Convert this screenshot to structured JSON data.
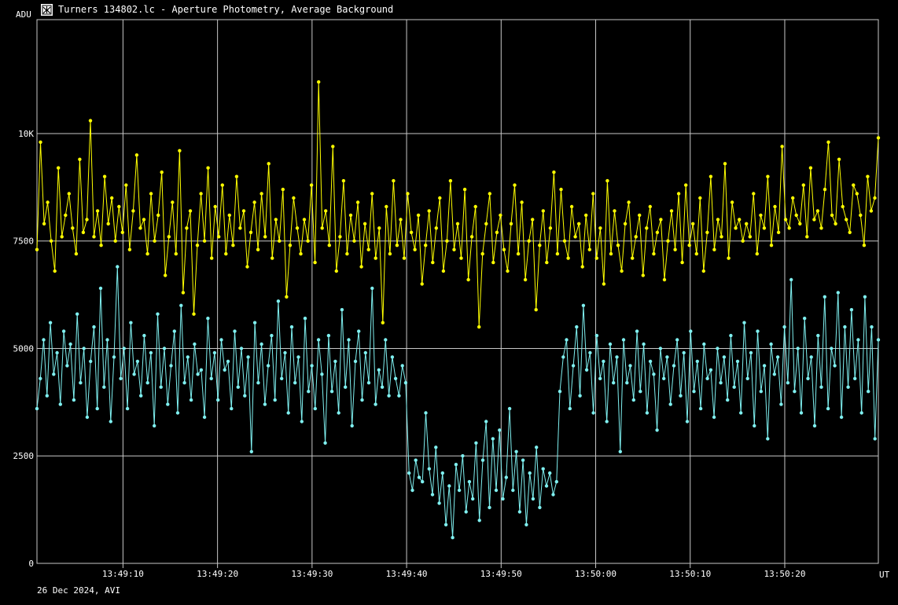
{
  "window": {
    "title": "Turners 134802.lc - Aperture Photometry, Average Background",
    "icon": "photometry-app-icon"
  },
  "footer": {
    "date_text": "26 Dec 2024, AVI"
  },
  "colors": {
    "background": "#000000",
    "grid": "#c8c8c8",
    "series_target": "#ffff00",
    "series_comparison": "#7ff0f0"
  },
  "chart_data": {
    "type": "line",
    "title": "Turners 134802.lc - Aperture Photometry, Average Background",
    "xlabel": "UT",
    "ylabel": "ADU",
    "x_start": "13:49:00.9",
    "x_end": "13:50:29.9",
    "x_tick_labels": [
      "13:49:10",
      "13:49:20",
      "13:49:30",
      "13:49:40",
      "13:49:50",
      "13:50:00",
      "13:50:10",
      "13:50:20"
    ],
    "y_tick_labels": [
      "0",
      "2500",
      "5000",
      "7500",
      "10K"
    ],
    "y_ticks": [
      0,
      2500,
      5000,
      7500,
      10000
    ],
    "ylim": [
      0,
      12650
    ],
    "grid": true,
    "series": [
      {
        "color": "#ffff00",
        "values": [
          7300,
          9800,
          7900,
          8400,
          7500,
          6800,
          9200,
          7600,
          8100,
          8600,
          7800,
          7200,
          9400,
          7700,
          8000,
          10300,
          7600,
          8200,
          7400,
          9000,
          7900,
          8500,
          7500,
          8300,
          7700,
          8800,
          7300,
          8200,
          9500,
          7800,
          8000,
          7200,
          8600,
          7500,
          8100,
          9100,
          6700,
          7600,
          8400,
          7200,
          9600,
          6300,
          7800,
          8200,
          5800,
          7400,
          8600,
          7500,
          9200,
          7100,
          8300,
          7600,
          8800,
          7200,
          8100,
          7400,
          9000,
          7800,
          8200,
          6900,
          7700,
          8400,
          7300,
          8600,
          7600,
          9300,
          7100,
          8000,
          7500,
          8700,
          6200,
          7400,
          8500,
          7800,
          7200,
          8000,
          7500,
          8800,
          7000,
          11200,
          7800,
          8200,
          7400,
          9700,
          6800,
          7600,
          8900,
          7200,
          8100,
          7500,
          8400,
          6900,
          7900,
          7300,
          8600,
          7100,
          7800,
          5600,
          8300,
          7200,
          8900,
          7400,
          8000,
          7100,
          8600,
          7700,
          7300,
          8100,
          6500,
          7400,
          8200,
          7000,
          7800,
          8500,
          6800,
          7500,
          8900,
          7300,
          7900,
          7100,
          8700,
          6600,
          7600,
          8300,
          5500,
          7200,
          7900,
          8600,
          7000,
          7700,
          8100,
          7300,
          6800,
          7900,
          8800,
          7200,
          8400,
          6600,
          7500,
          8000,
          5900,
          7400,
          8200,
          7000,
          7800,
          9100,
          7200,
          8700,
          7500,
          7100,
          8300,
          7600,
          7900,
          6900,
          8100,
          7300,
          8600,
          7100,
          7800,
          6500,
          8900,
          7200,
          8200,
          7400,
          6800,
          7900,
          8400,
          7100,
          7600,
          8100,
          6700,
          7800,
          8300,
          7200,
          7700,
          8000,
          6600,
          7500,
          8200,
          7300,
          8600,
          7000,
          8800,
          7400,
          7900,
          7200,
          8500,
          6800,
          7700,
          9000,
          7300,
          8000,
          7600,
          9300,
          7100,
          8400,
          7800,
          8000,
          7500,
          7900,
          7600,
          8600,
          7200,
          8100,
          7800,
          9000,
          7400,
          8300,
          7700,
          9700,
          8000,
          7800,
          8500,
          8100,
          7900,
          8800,
          7600,
          9200,
          8000,
          8200,
          7800,
          8700,
          9800,
          8100,
          7900,
          9400,
          8300,
          8000,
          7700,
          8800,
          8600,
          8100,
          7400,
          9000,
          8200,
          8500,
          9900
        ]
      },
      {
        "color": "#7ff0f0",
        "values": [
          3600,
          4300,
          5200,
          3900,
          5600,
          4400,
          4900,
          3700,
          5400,
          4600,
          5100,
          3800,
          5800,
          4200,
          5000,
          3400,
          4700,
          5500,
          3600,
          6400,
          4100,
          5200,
          3300,
          4800,
          6900,
          4300,
          5000,
          3600,
          5600,
          4400,
          4700,
          3900,
          5300,
          4200,
          4900,
          3200,
          5800,
          4100,
          5000,
          3700,
          4600,
          5400,
          3500,
          6000,
          4200,
          4800,
          3800,
          5100,
          4400,
          4500,
          3400,
          5700,
          4300,
          4900,
          3800,
          5200,
          4500,
          4700,
          3600,
          5400,
          4100,
          5000,
          3900,
          4800,
          2600,
          5600,
          4200,
          5100,
          3700,
          4600,
          5300,
          3800,
          6100,
          4300,
          4900,
          3500,
          5500,
          4200,
          4800,
          3300,
          5700,
          4000,
          4600,
          3600,
          5200,
          4400,
          2800,
          5300,
          4000,
          4700,
          3500,
          5900,
          4100,
          5200,
          3200,
          4700,
          5400,
          3800,
          4900,
          4200,
          6400,
          3700,
          4500,
          4100,
          5200,
          3900,
          4800,
          4300,
          3900,
          4600,
          4200,
          2100,
          1700,
          2400,
          2000,
          1900,
          3500,
          2200,
          1600,
          2700,
          1400,
          2100,
          900,
          1800,
          600,
          2300,
          1700,
          2500,
          1200,
          1900,
          1500,
          2800,
          1000,
          2400,
          3300,
          1300,
          2900,
          1700,
          3100,
          1500,
          2000,
          3600,
          1700,
          2600,
          1200,
          2400,
          900,
          2100,
          1500,
          2700,
          1300,
          2200,
          1800,
          2100,
          1600,
          1900,
          4000,
          4800,
          5200,
          3600,
          4600,
          5500,
          3900,
          6000,
          4500,
          4900,
          3500,
          5300,
          4300,
          4700,
          3300,
          5100,
          4200,
          4800,
          2600,
          5200,
          4200,
          4600,
          3800,
          5400,
          4000,
          5100,
          3500,
          4700,
          4400,
          3100,
          5000,
          4300,
          4800,
          3700,
          4600,
          5200,
          3900,
          4900,
          3300,
          5400,
          4000,
          4700,
          3600,
          5100,
          4300,
          4500,
          3400,
          5000,
          4200,
          4800,
          3800,
          5300,
          4100,
          4700,
          3500,
          5600,
          4300,
          4900,
          3200,
          5400,
          4000,
          4600,
          2900,
          5100,
          4400,
          4800,
          3700,
          5500,
          4200,
          6600,
          4000,
          5000,
          3500,
          5700,
          4300,
          4800,
          3200,
          5300,
          4100,
          6200,
          3600,
          5000,
          4600,
          6300,
          3400,
          5500,
          4100,
          5900,
          4300,
          5200,
          3500,
          6200,
          4000,
          5500,
          2900,
          5200
        ]
      }
    ]
  }
}
